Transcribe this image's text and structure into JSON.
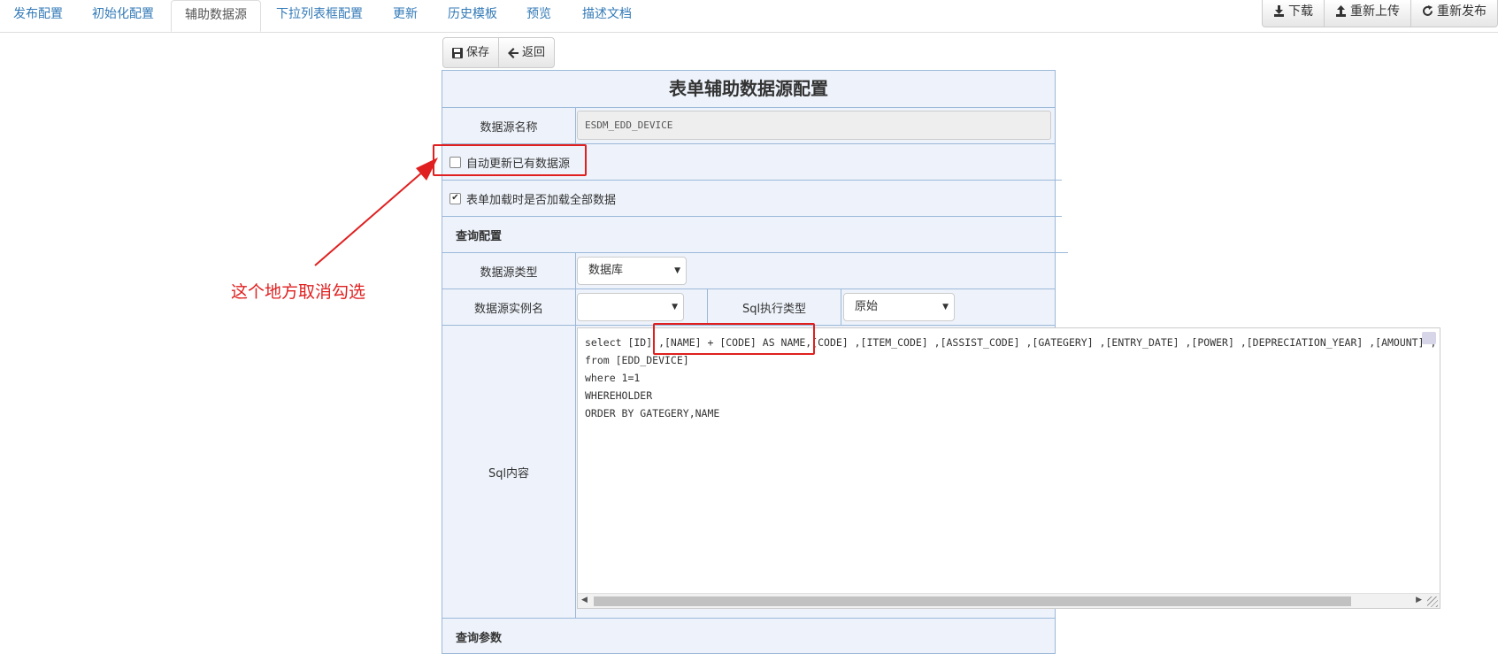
{
  "tabs": [
    {
      "label": "发布配置",
      "active": false
    },
    {
      "label": "初始化配置",
      "active": false
    },
    {
      "label": "辅助数据源",
      "active": true
    },
    {
      "label": "下拉列表框配置",
      "active": false
    },
    {
      "label": "更新",
      "active": false
    },
    {
      "label": "历史模板",
      "active": false
    },
    {
      "label": "预览",
      "active": false
    },
    {
      "label": "描述文档",
      "active": false
    }
  ],
  "top_actions": {
    "download": "下载",
    "reupload": "重新上传",
    "republish": "重新发布"
  },
  "toolbar": {
    "save": "保存",
    "back": "返回"
  },
  "form": {
    "title": "表单辅助数据源配置",
    "datasource_name_label": "数据源名称",
    "datasource_name_value": "ESDM_EDD_DEVICE",
    "auto_update_label": "自动更新已有数据源",
    "auto_update_checked": false,
    "load_all_label": "表单加载时是否加载全部数据",
    "load_all_checked": true,
    "query_config_section": "查询配置",
    "datasource_type_label": "数据源类型",
    "datasource_type_value": "数据库",
    "instance_label": "数据源实例名",
    "instance_value": "",
    "sql_exec_type_label": "Sql执行类型",
    "sql_exec_type_value": "原始",
    "sql_content_label": "Sql内容",
    "sql_content": "select [ID] ,[NAME] + [CODE] AS NAME,[CODE] ,[ITEM_CODE] ,[ASSIST_CODE] ,[GATEGERY] ,[ENTRY_DATE] ,[POWER] ,[DEPRECIATION_YEAR] ,[AMOUNT] ,\nfrom [EDD_DEVICE]\nwhere 1=1\nWHEREHOLDER\nORDER BY GATEGERY,NAME",
    "query_params_section": "查询参数"
  },
  "annotation": {
    "note": "这个地方取消勾选",
    "color": "#e02020"
  },
  "colors": {
    "link": "#337ab7",
    "panel_bg": "#eef3fb",
    "panel_border": "#9bb8d8"
  }
}
